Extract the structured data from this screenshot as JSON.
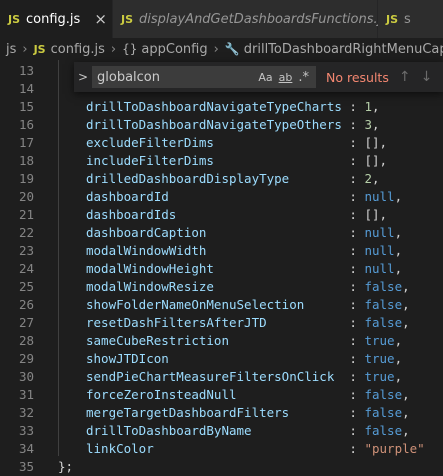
{
  "tabs": [
    {
      "icon": "JS",
      "label": "config.js",
      "active": true,
      "close": "×"
    },
    {
      "icon": "JS",
      "label": "displayAndGetDashboardsFunctions.js",
      "active": false
    },
    {
      "icon": "JS",
      "label": "s",
      "active": false
    }
  ],
  "breadcrumb": {
    "folder": "js",
    "file_icon": "JS",
    "file": "config.js",
    "object": "appConfig",
    "property": "drillToDashboardRightMenuCaptio"
  },
  "find": {
    "value": "globalcon",
    "match_case": "Aa",
    "whole_word": "ab",
    "regex": ".*",
    "status": "No results",
    "toggle": ">"
  },
  "lines": [
    {
      "n": "13",
      "prop": "",
      "colon": "",
      "value": "",
      "vtype": "",
      "comma": ""
    },
    {
      "n": "14",
      "prop": "",
      "colon": "",
      "value": "",
      "vtype": "",
      "comma": ""
    },
    {
      "n": "15",
      "prop": "drillToDashboardNavigateTypeCharts",
      "colon": ":",
      "value": "1",
      "vtype": "num",
      "comma": ","
    },
    {
      "n": "16",
      "prop": "drillToDashboardNavigateTypeOthers",
      "colon": ":",
      "value": "3",
      "vtype": "num",
      "comma": ","
    },
    {
      "n": "17",
      "prop": "excludeFilterDims",
      "colon": ":",
      "value": "[]",
      "vtype": "punc",
      "comma": ","
    },
    {
      "n": "18",
      "prop": "includeFilterDims",
      "colon": ":",
      "value": "[]",
      "vtype": "punc",
      "comma": ","
    },
    {
      "n": "19",
      "prop": "drilledDashboardDisplayType",
      "colon": ":",
      "value": "2",
      "vtype": "num",
      "comma": ","
    },
    {
      "n": "20",
      "prop": "dashboardId",
      "colon": ":",
      "value": "null",
      "vtype": "kw",
      "comma": ","
    },
    {
      "n": "21",
      "prop": "dashboardIds",
      "colon": ":",
      "value": "[]",
      "vtype": "punc",
      "comma": ","
    },
    {
      "n": "22",
      "prop": "dashboardCaption",
      "colon": ":",
      "value": "null",
      "vtype": "kw",
      "comma": ","
    },
    {
      "n": "23",
      "prop": "modalWindowWidth",
      "colon": ":",
      "value": "null",
      "vtype": "kw",
      "comma": ","
    },
    {
      "n": "24",
      "prop": "modalWindowHeight",
      "colon": ":",
      "value": "null",
      "vtype": "kw",
      "comma": ","
    },
    {
      "n": "25",
      "prop": "modalWindowResize",
      "colon": ":",
      "value": "false",
      "vtype": "kw",
      "comma": ","
    },
    {
      "n": "26",
      "prop": "showFolderNameOnMenuSelection",
      "colon": ":",
      "value": "false",
      "vtype": "kw",
      "comma": ","
    },
    {
      "n": "27",
      "prop": "resetDashFiltersAfterJTD",
      "colon": ":",
      "value": "false",
      "vtype": "kw",
      "comma": ","
    },
    {
      "n": "28",
      "prop": "sameCubeRestriction",
      "colon": ":",
      "value": "true",
      "vtype": "kw",
      "comma": ","
    },
    {
      "n": "29",
      "prop": "showJTDIcon",
      "colon": ":",
      "value": "true",
      "vtype": "kw",
      "comma": ","
    },
    {
      "n": "30",
      "prop": "sendPieChartMeasureFiltersOnClick",
      "colon": ":",
      "value": "true",
      "vtype": "kw",
      "comma": ","
    },
    {
      "n": "31",
      "prop": "forceZeroInsteadNull",
      "colon": ":",
      "value": "false",
      "vtype": "kw",
      "comma": ","
    },
    {
      "n": "32",
      "prop": "mergeTargetDashboardFilters",
      "colon": ":",
      "value": "false",
      "vtype": "kw",
      "comma": ","
    },
    {
      "n": "33",
      "prop": "drillToDashboardByName",
      "colon": ":",
      "value": "false",
      "vtype": "kw",
      "comma": ","
    },
    {
      "n": "34",
      "prop": "linkColor",
      "colon": ":",
      "value": "\"purple\"",
      "vtype": "str",
      "comma": ""
    },
    {
      "n": "35",
      "prop": "",
      "colon": "",
      "value": "",
      "vtype": "",
      "comma": "",
      "closing": "};"
    }
  ],
  "colors": {
    "editor_bg": "#1e1e1e",
    "property": "#9cdcfe",
    "number": "#b5cea8",
    "keyword": "#569cd6",
    "string": "#ce9178",
    "no_results": "#f48771"
  }
}
